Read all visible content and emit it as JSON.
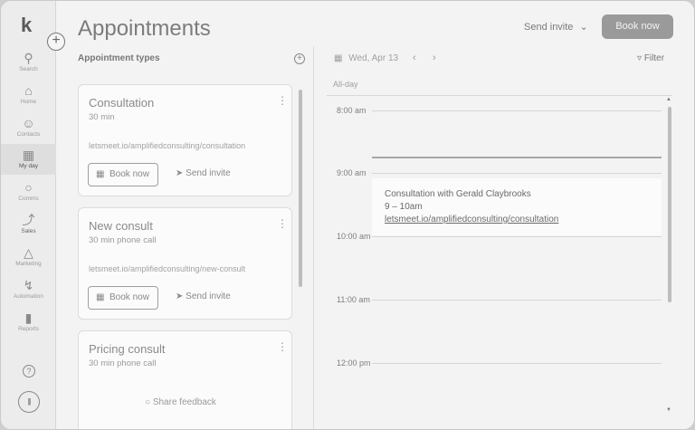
{
  "sidebar": {
    "logo": "k",
    "add_icon": "plus-circle-icon",
    "items": [
      {
        "label": "Search",
        "icon": "search-icon"
      },
      {
        "label": "Home",
        "icon": "home-icon"
      },
      {
        "label": "Contacts",
        "icon": "contacts-icon"
      },
      {
        "label": "My day",
        "icon": "calendar-icon"
      },
      {
        "label": "Comms",
        "icon": "chat-icon"
      },
      {
        "label": "Sales",
        "icon": "sales-icon"
      },
      {
        "label": "Marketing",
        "icon": "megaphone-icon"
      },
      {
        "label": "Automation",
        "icon": "lightning-icon"
      },
      {
        "label": "Reports",
        "icon": "bar-chart-icon"
      }
    ],
    "help_icon": "question-icon",
    "avatar_icon": "avatar-icon"
  },
  "header": {
    "title": "Appointments",
    "send_invite": "Send invite",
    "book_now": "Book now"
  },
  "appointment_types": {
    "label": "Appointment types",
    "cards": [
      {
        "title": "Consultation",
        "subtitle": "30 min",
        "url": "letsmeet.io/amplifiedconsulting/consultation",
        "book": "Book now",
        "invite": "Send invite"
      },
      {
        "title": "New consult",
        "subtitle": "30 min phone call",
        "url": "letsmeet.io/amplifiedconsulting/new-consult",
        "book": "Book now",
        "invite": "Send invite"
      },
      {
        "title": "Pricing consult",
        "subtitle": "30 min phone call"
      }
    ],
    "share_feedback": "Share feedback"
  },
  "calendar": {
    "date": "Wed, Apr 13",
    "filter": "Filter",
    "all_day": "All-day",
    "times": [
      "8:00 am",
      "9:00 am",
      "10:00 am",
      "11:00 am",
      "12:00 pm"
    ],
    "event": {
      "name": "Consultation with Gerald Claybrooks",
      "time": "9 – 10am",
      "url": "letsmeet.io/amplifiedconsulting/consultation"
    }
  },
  "colors": {
    "primary_button": "#9a9a9a",
    "background": "#f3f3f3"
  }
}
